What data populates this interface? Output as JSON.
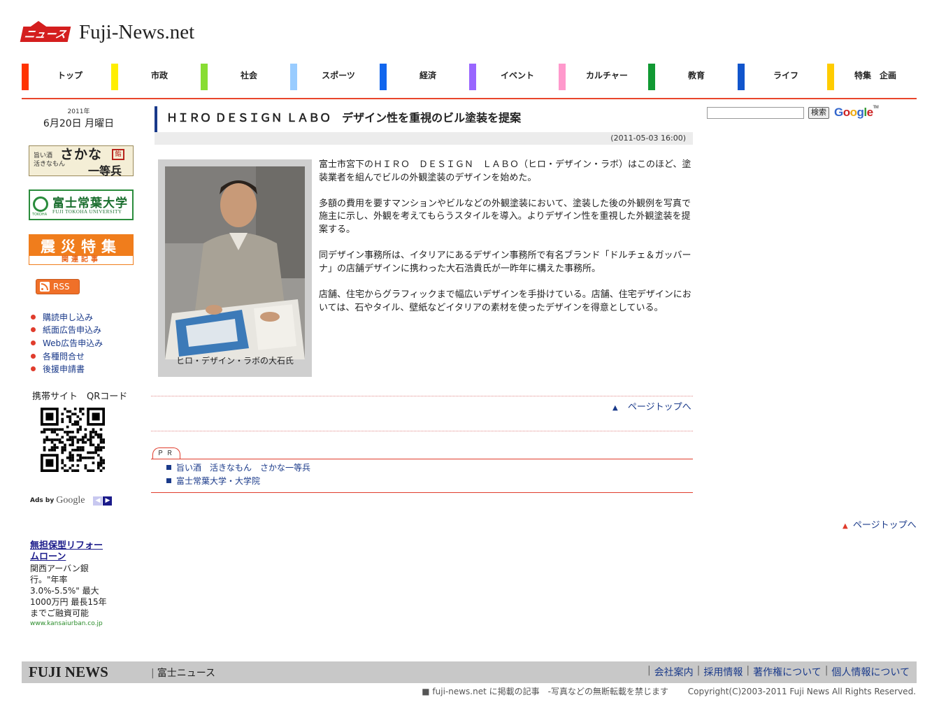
{
  "site": {
    "logo_text": "ニュース",
    "name": "Fuji-News.net"
  },
  "nav": [
    {
      "label": "トップ",
      "color": "#ff3300"
    },
    {
      "label": "市政",
      "color": "#ffee00"
    },
    {
      "label": "社会",
      "color": "#88dd33"
    },
    {
      "label": "スポーツ",
      "color": "#99ccff"
    },
    {
      "label": "経済",
      "color": "#1166ee"
    },
    {
      "label": "イベント",
      "color": "#9966ff"
    },
    {
      "label": "カルチャー",
      "color": "#ff99cc"
    },
    {
      "label": "教育",
      "color": "#119933"
    },
    {
      "label": "ライフ",
      "color": "#1155cc"
    },
    {
      "label": "特集　企画",
      "color": "#ffcc00"
    }
  ],
  "sidebar": {
    "year": "2011年",
    "date": "6月20日 月曜日",
    "banners": {
      "sakana_small": "旨い酒\n活きなもん",
      "sakana_big": "さかな",
      "sakana_big2": "一等兵",
      "sakana_seal": "鮨",
      "tokoha_jp": "富士常葉大学",
      "tokoha_en": "FUJI TOKOHA UNIVERSITY",
      "tokoha_small": "TOKOHA",
      "shinsai_title": "震災特集",
      "shinsai_sub": "関連記事"
    },
    "rss_label": "RSS",
    "links": [
      "購読申し込み",
      "紙面広告申込み",
      "Web広告申込み",
      "各種問合せ",
      "後援申請書"
    ],
    "qr_title": "携帯サイト　QRコード",
    "ads_by": "Ads by",
    "ads_google": "Google",
    "ad": {
      "title": "無担保型リフォームローン",
      "desc": "関西アーバン銀行。\"年率3.0%-5.5%\" 最大1000万円 最長15年までご融資可能",
      "url": "www.kansaiurban.co.jp"
    }
  },
  "article": {
    "title": "ＨＩＲＯ ＤＥＳＩＧＮ ＬＡＢＯ　デザイン性を重視のビル塗装を提案",
    "date": "(2011-05-03 16:00)",
    "photo_caption": "ヒロ・デザイン・ラボの大石氏",
    "paragraphs": [
      "富士市宮下のＨＩＲＯ　ＤＥＳＩＧＮ　ＬＡＢＯ（ヒロ・デザイン・ラボ）はこのほど、塗装業者を組んでビルの外観塗装のデザインを始めた。",
      "多額の費用を要すマンションやビルなどの外観塗装において、塗装した後の外観例を写真で施主に示し、外観を考えてもらうスタイルを導入。よりデザイン性を重視した外観塗装を提案する。",
      "同デザイン事務所は、イタリアにあるデザイン事務所で有名ブランド「ドルチェ＆ガッバーナ」の店舗デザインに携わった大石浩貴氏が一昨年に構えた事務所。",
      "店舗、住宅からグラフィックまで幅広いデザインを手掛けている。店舗、住宅デザインにおいては、石やタイル、壁紙などイタリアの素材を使ったデザインを得意としている。"
    ],
    "page_top": "ページトップへ",
    "pr_label": "ＰＲ",
    "pr_links": [
      "旨い酒　活きなもん　さかな一等兵",
      "富士常葉大学・大学院"
    ]
  },
  "search": {
    "button": "検索",
    "google": [
      "G",
      "o",
      "o",
      "g",
      "l",
      "e"
    ],
    "google_tm": "TM"
  },
  "page_top_right": "ページトップへ",
  "footer": {
    "brand": "FUJI NEWS",
    "sub": "富士ニュース",
    "links": [
      "会社案内",
      "採用情報",
      "著作権について",
      "個人情報について"
    ],
    "notice": "■ fuji-news.net に掲載の記事　-写真などの無断転載を禁じます",
    "copyright": "Copyright(C)2003-2011 Fuji News All Rights Reserved."
  }
}
